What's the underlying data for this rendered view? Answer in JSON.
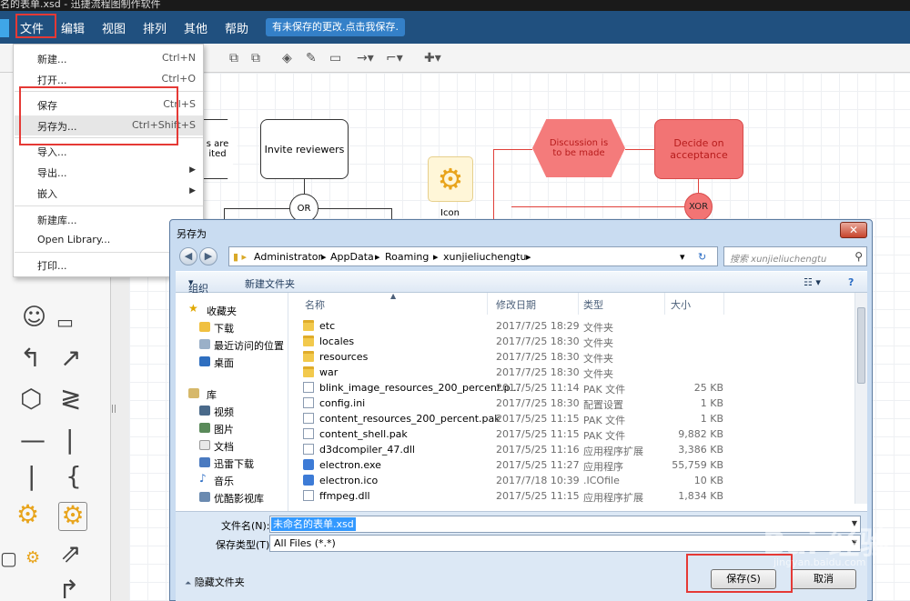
{
  "window": {
    "title": "名的表单.xsd - 迅捷流程图制作软件"
  },
  "menubar": {
    "items": [
      "文件",
      "编辑",
      "视图",
      "排列",
      "其他",
      "帮助"
    ],
    "unsaved_notice": "有未保存的更改.点击我保存."
  },
  "file_menu": {
    "items": [
      {
        "label": "新建...",
        "shortcut": "Ctrl+N"
      },
      {
        "label": "打开...",
        "shortcut": "Ctrl+O"
      },
      {
        "label": "保存",
        "shortcut": "Ctrl+S"
      },
      {
        "label": "另存为...",
        "shortcut": "Ctrl+Shift+S"
      },
      {
        "label": "导入..."
      },
      {
        "label": "导出..."
      },
      {
        "label": "嵌入"
      },
      {
        "label": "新建库..."
      },
      {
        "label": "Open Library..."
      },
      {
        "label": "打印..."
      }
    ]
  },
  "diagram": {
    "hex_partial": "s are\nited",
    "invite": "Invite reviewers",
    "or": "OR",
    "icon_label": "Icon",
    "discussion": "Discussion is\nto be made",
    "decide": "Decide on\nacceptance",
    "xor": "XOR"
  },
  "dialog": {
    "title": "另存为",
    "close": "✕",
    "breadcrumbs": [
      "Administrator",
      "AppData",
      "Roaming",
      "xunjieliuchengtu"
    ],
    "search_placeholder": "搜索 xunjieliuchengtu",
    "organize": "组织",
    "new_folder": "新建文件夹",
    "nav": {
      "favorites": "收藏夹",
      "items": [
        "下载",
        "最近访问的位置",
        "桌面"
      ],
      "library": "库",
      "lib_items": [
        "视频",
        "图片",
        "文档",
        "迅雷下载",
        "音乐",
        "优酷影视库"
      ]
    },
    "columns": [
      "名称",
      "修改日期",
      "类型",
      "大小"
    ],
    "files": [
      {
        "name": "etc",
        "date": "2017/7/25 18:29",
        "type": "文件夹",
        "size": "",
        "icon": "folder"
      },
      {
        "name": "locales",
        "date": "2017/7/25 18:30",
        "type": "文件夹",
        "size": "",
        "icon": "folder"
      },
      {
        "name": "resources",
        "date": "2017/7/25 18:30",
        "type": "文件夹",
        "size": "",
        "icon": "folder"
      },
      {
        "name": "war",
        "date": "2017/7/25 18:30",
        "type": "文件夹",
        "size": "",
        "icon": "folder"
      },
      {
        "name": "blink_image_resources_200_percent.p...",
        "date": "2017/5/25 11:14",
        "type": "PAK 文件",
        "size": "25 KB",
        "icon": "doc"
      },
      {
        "name": "config.ini",
        "date": "2017/7/25 18:30",
        "type": "配置设置",
        "size": "1 KB",
        "icon": "doc"
      },
      {
        "name": "content_resources_200_percent.pak",
        "date": "2017/5/25 11:15",
        "type": "PAK 文件",
        "size": "1 KB",
        "icon": "doc"
      },
      {
        "name": "content_shell.pak",
        "date": "2017/5/25 11:15",
        "type": "PAK 文件",
        "size": "9,882 KB",
        "icon": "doc"
      },
      {
        "name": "d3dcompiler_47.dll",
        "date": "2017/5/25 11:16",
        "type": "应用程序扩展",
        "size": "3,386 KB",
        "icon": "doc"
      },
      {
        "name": "electron.exe",
        "date": "2017/5/25 11:27",
        "type": "应用程序",
        "size": "55,759 KB",
        "icon": "exe"
      },
      {
        "name": "electron.ico",
        "date": "2017/7/18 10:39",
        "type": ".ICOfile",
        "size": "10 KB",
        "icon": "exe"
      },
      {
        "name": "ffmpeg.dll",
        "date": "2017/5/25 11:15",
        "type": "应用程序扩展",
        "size": "1,834 KB",
        "icon": "doc"
      }
    ],
    "filename_label": "文件名(N):",
    "filename_value": "未命名的表单.xsd",
    "type_label": "保存类型(T):",
    "type_value": "All Files (*.*)",
    "hide_folders": "隐藏文件夹",
    "save": "保存(S)",
    "cancel": "取消"
  },
  "watermark": {
    "text": "Bai 经验",
    "sub": "jingyan.baidu.com"
  },
  "colors": {
    "menubar": "#20507f",
    "highlight": "#e53935",
    "accent_red": "#f26b6b"
  }
}
